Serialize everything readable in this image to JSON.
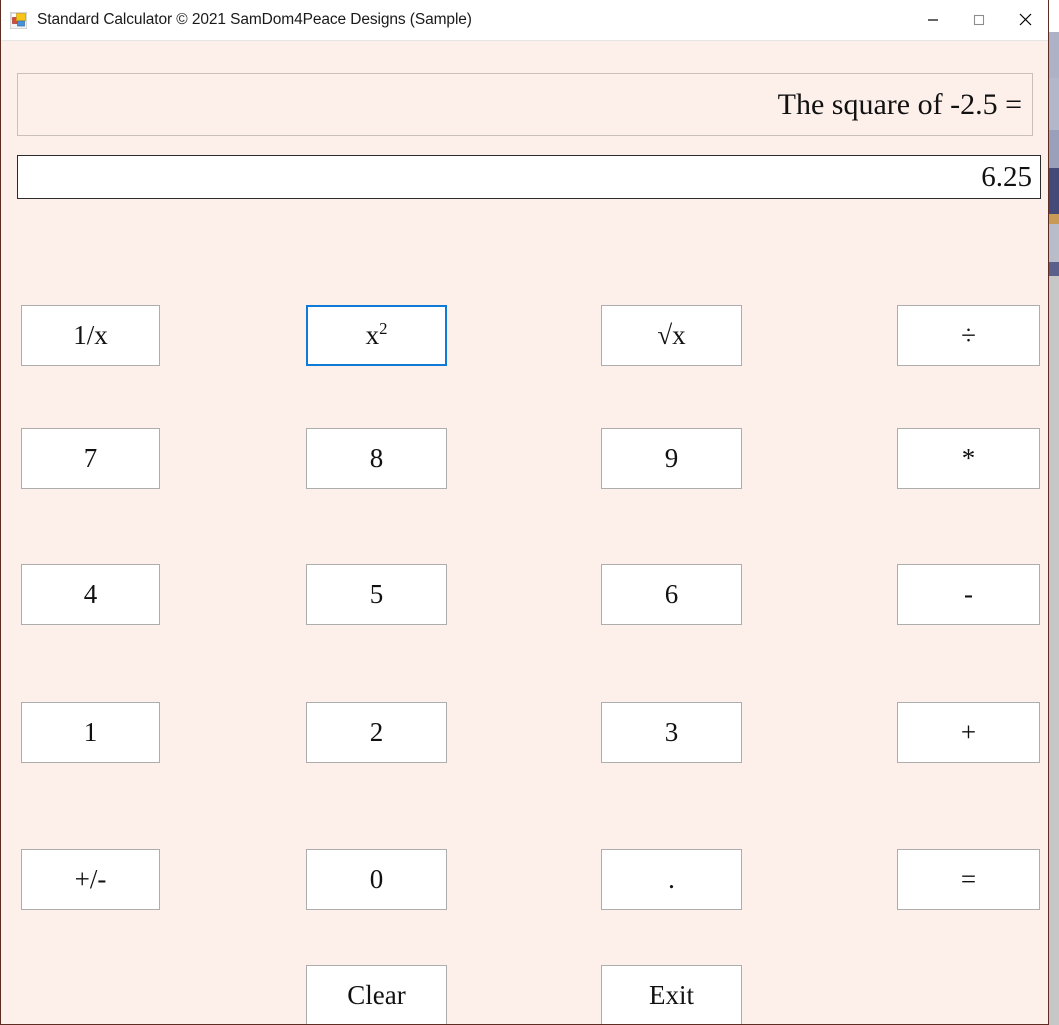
{
  "window": {
    "title": "Standard Calculator © 2021 SamDom4Peace Designs (Sample)",
    "icon": "winforms-app-icon",
    "controls": {
      "minimize": "minimize-icon",
      "maximize": "maximize-icon",
      "close": "close-icon"
    },
    "background_color": "#fdf0ea",
    "border_color": "#5d2c23"
  },
  "display": {
    "expression": "The square of -2.5 =",
    "result": "6.25"
  },
  "focus": {
    "focused_button_id": "square",
    "focus_color": "#0f7ad8"
  },
  "keypad": {
    "buttons": [
      {
        "id": "reciprocal",
        "label": "1/x",
        "sup": "",
        "col": 0,
        "row": 0,
        "focused": false
      },
      {
        "id": "square",
        "label": "x",
        "sup": "2",
        "col": 1,
        "row": 0,
        "focused": true
      },
      {
        "id": "sqrt",
        "label": "√x",
        "sup": "",
        "col": 2,
        "row": 0,
        "focused": false
      },
      {
        "id": "divide",
        "label": "÷",
        "sup": "",
        "col": 3,
        "row": 0,
        "focused": false
      },
      {
        "id": "seven",
        "label": "7",
        "sup": "",
        "col": 0,
        "row": 1,
        "focused": false
      },
      {
        "id": "eight",
        "label": "8",
        "sup": "",
        "col": 1,
        "row": 1,
        "focused": false
      },
      {
        "id": "nine",
        "label": "9",
        "sup": "",
        "col": 2,
        "row": 1,
        "focused": false
      },
      {
        "id": "multiply",
        "label": "*",
        "sup": "",
        "col": 3,
        "row": 1,
        "focused": false
      },
      {
        "id": "four",
        "label": "4",
        "sup": "",
        "col": 0,
        "row": 2,
        "focused": false
      },
      {
        "id": "five",
        "label": "5",
        "sup": "",
        "col": 1,
        "row": 2,
        "focused": false
      },
      {
        "id": "six",
        "label": "6",
        "sup": "",
        "col": 2,
        "row": 2,
        "focused": false
      },
      {
        "id": "subtract",
        "label": "-",
        "sup": "",
        "col": 3,
        "row": 2,
        "focused": false
      },
      {
        "id": "one",
        "label": "1",
        "sup": "",
        "col": 0,
        "row": 3,
        "focused": false
      },
      {
        "id": "two",
        "label": "2",
        "sup": "",
        "col": 1,
        "row": 3,
        "focused": false
      },
      {
        "id": "three",
        "label": "3",
        "sup": "",
        "col": 2,
        "row": 3,
        "focused": false
      },
      {
        "id": "add",
        "label": "+",
        "sup": "",
        "col": 3,
        "row": 3,
        "focused": false
      },
      {
        "id": "sign-toggle",
        "label": "+/-",
        "sup": "",
        "col": 0,
        "row": 4,
        "focused": false
      },
      {
        "id": "zero",
        "label": "0",
        "sup": "",
        "col": 1,
        "row": 4,
        "focused": false
      },
      {
        "id": "decimal",
        "label": ".",
        "sup": "",
        "col": 2,
        "row": 4,
        "focused": false
      },
      {
        "id": "equals",
        "label": "=",
        "sup": "",
        "col": 3,
        "row": 4,
        "focused": false
      },
      {
        "id": "clear",
        "label": "Clear",
        "sup": "",
        "col": 1,
        "row": 5,
        "focused": false
      },
      {
        "id": "exit",
        "label": "Exit",
        "sup": "",
        "col": 2,
        "row": 5,
        "focused": false
      }
    ]
  }
}
